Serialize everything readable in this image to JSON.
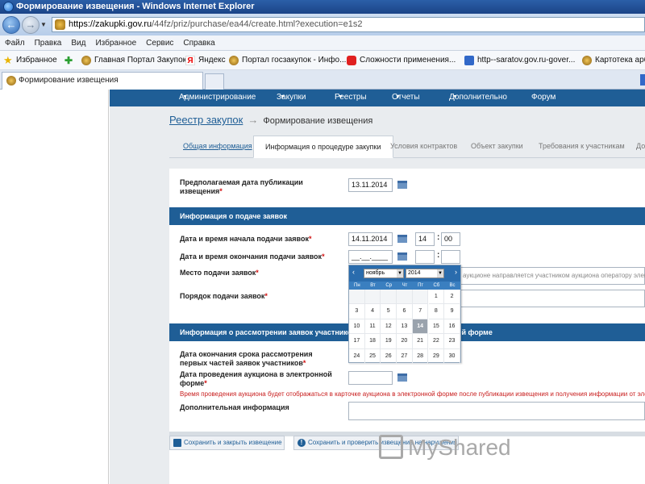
{
  "window": {
    "title": "Формирование извещения - Windows Internet Explorer"
  },
  "address": {
    "host": "https://zakupki.gov.ru",
    "path": "/44fz/priz/purchase/ea44/create.html?execution=e1s2"
  },
  "menu": [
    "Файл",
    "Правка",
    "Вид",
    "Избранное",
    "Сервис",
    "Справка"
  ],
  "favorites": {
    "label": "Избранное",
    "items": [
      "Главная Портал Закупок",
      "Яндекс",
      "Портал госзакупок - Инфо...",
      "Сложности применения...",
      "http--saratov.gov.ru-gover...",
      "Картотека арб"
    ]
  },
  "browser_tab": {
    "label": "Формирование извещения"
  },
  "topnav": [
    "Администрирование",
    "Закупки",
    "Реестры",
    "Отчеты",
    "Дополнительно",
    "Форум"
  ],
  "breadcrumb": {
    "link": "Реестр закупок",
    "arrow": "→",
    "current": "Формирование извещения"
  },
  "subtabs": [
    "Общая информация",
    "Информация о процедуре закупки",
    "Условия контрактов",
    "Объект закупки",
    "Требования к участникам",
    "До"
  ],
  "form": {
    "publication_date_label": "Предполагаемая дата публикации извещения",
    "publication_date": "13.11.2014",
    "section_applications": "Информация о подаче заявок",
    "start_label": "Дата и время начала подачи заявок",
    "start_date": "14.11.2014",
    "start_hour": "14",
    "start_minute": "00",
    "end_label": "Дата и время окончания подачи заявок",
    "end_date": "__.__.____",
    "place_label": "Место подачи заявок",
    "place_hint": "аукционе направляется участником аукциона оператору электро",
    "order_label": "Порядок подачи заявок",
    "section_review": "Информация о рассмотрении заявок участников и п",
    "section_review_tail": "ой форме",
    "review_end_label": "Дата окончания срока рассмотрения первых частей заявок участников",
    "auction_date_label": "Дата проведения аукциона в электронной форме",
    "auction_time_note": "Время проведения аукциона будет отображаться в карточке аукциона в электронной форме после публикации извещения и получения информации от элек",
    "extra_info_label": "Дополнительная информация",
    "required_mark": "*"
  },
  "actions": {
    "save_close": "Сохранить и закрыть извещение",
    "save_check": "Сохранить и проверить извещение на нарушения"
  },
  "calendar": {
    "month": "ноябрь",
    "year": "2014",
    "prev": "‹",
    "next": "›",
    "dows": [
      "Пн",
      "Вт",
      "Ср",
      "Чт",
      "Пт",
      "Сб",
      "Вс"
    ],
    "weeks": [
      [
        "",
        "",
        "",
        "",
        "",
        "1",
        "2"
      ],
      [
        "3",
        "4",
        "5",
        "6",
        "7",
        "8",
        "9"
      ],
      [
        "10",
        "11",
        "12",
        "13",
        "14",
        "15",
        "16"
      ],
      [
        "17",
        "18",
        "19",
        "20",
        "21",
        "22",
        "23"
      ],
      [
        "24",
        "25",
        "26",
        "27",
        "28",
        "29",
        "30"
      ]
    ],
    "highlighted": "14"
  },
  "watermark": "MyShared",
  "colors": {
    "nav": "#1f5e96",
    "required": "#d01010"
  }
}
